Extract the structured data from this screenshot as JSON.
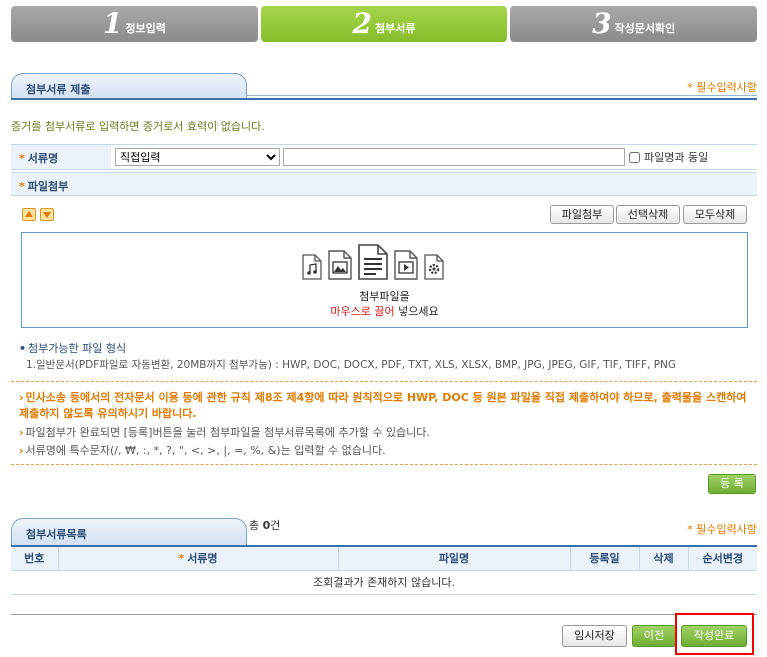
{
  "steps": [
    {
      "num": "1",
      "label": "정보입력"
    },
    {
      "num": "2",
      "label": "첨부서류"
    },
    {
      "num": "3",
      "label": "작성문서확인"
    }
  ],
  "section1": {
    "title": "첨부서류 제출",
    "required_note": "* 필수입력사항",
    "description": "증거를 첨부서류로 입력하면 증거로서 효력이 없습니다."
  },
  "doc_name_row": {
    "label": "서류명",
    "select_value": "직접입력",
    "input_value": "",
    "checkbox_label": "파일명과 동일"
  },
  "attach_row": {
    "label": "파일첨부"
  },
  "file_buttons": {
    "attach": "파일첨부",
    "delete_selected": "선택삭제",
    "delete_all": "모두삭제"
  },
  "dropzone": {
    "line1": "첨부파일을",
    "line2_red": "마우스로 끌어",
    "line2_rest": " 넣으세요",
    "icons": [
      "audio-file-icon",
      "image-file-icon",
      "document-file-icon",
      "video-file-icon",
      "settings-file-icon"
    ]
  },
  "file_types": {
    "title": "첨부가능한 파일 형식",
    "list": "1.일반문서(PDF파일로 자동변환, 20MB까지 첨부가능) : HWP, DOC, DOCX, PDF, TXT, XLS, XLSX, BMP, JPG, JPEG, GIF, TIF, TIFF, PNG"
  },
  "notices": {
    "warning": "민사소송 등에서의 전자문서 이용 등에 관한 규칙 제8조 제4항에 따라 원칙적으로 HWP, DOC 등 원본 파일을 직접 제출하여야 하므로, 출력물을 스캔하여 제출하지 않도록 유의하시기 바랍니다.",
    "note1": "파일첨부가 완료되면 [등록]버튼을 눌러 첨부파일을 첨부서류목록에 추가할 수 있습니다.",
    "note2": "서류명에 특수문자(/, ₩, :, *, ?, \", <, >, |, =, %, &)는 입력할 수 없습니다."
  },
  "register_button": "등 록",
  "section2": {
    "title": "첨부서류목록",
    "count_prefix": "총 ",
    "count_value": "0",
    "count_suffix": "건",
    "required_note": "* 필수입력사항",
    "columns": [
      "번호",
      "서류명",
      "파일명",
      "등록일",
      "삭제",
      "순서변경"
    ],
    "empty_message": "조회결과가 존재하지 않습니다."
  },
  "footer_buttons": {
    "temp_save": "임시저장",
    "prev": "이전",
    "complete": "작성완료"
  },
  "colors": {
    "accent_green": "#86bd2a",
    "accent_blue": "#3c6fa8",
    "accent_orange": "#e07a00",
    "highlight_red": "#ee0000"
  }
}
